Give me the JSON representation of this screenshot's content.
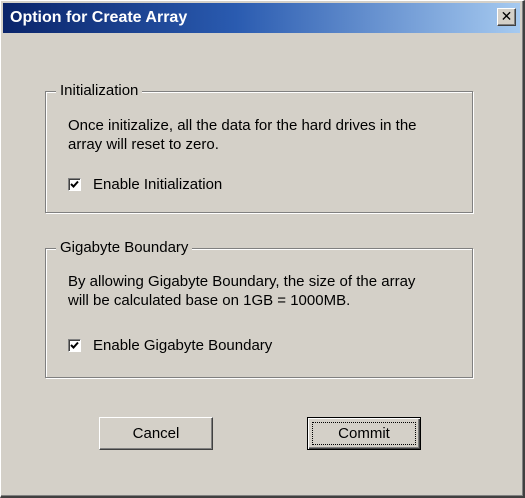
{
  "window": {
    "title": "Option for Create Array",
    "close_glyph": "✕"
  },
  "initialization": {
    "legend": "Initialization",
    "description_lines": [
      "Once initizalize, all the data for the hard drives in the",
      "array will reset to zero."
    ],
    "checkbox_label": "Enable Initialization",
    "checked": true
  },
  "gigabyte_boundary": {
    "legend": "Gigabyte Boundary",
    "description_lines": [
      "By allowing Gigabyte Boundary, the size of the array",
      "will be calculated base on 1GB = 1000MB."
    ],
    "checkbox_label": "Enable Gigabyte Boundary",
    "checked": true
  },
  "buttons": {
    "cancel_label": "Cancel",
    "commit_label": "Commit"
  },
  "colors": {
    "dialog_face": "#d4d0c8",
    "title_start": "#0a246a",
    "title_end": "#a6caf0"
  },
  "icons": {
    "close": "close-icon",
    "check": "checkmark-icon"
  }
}
